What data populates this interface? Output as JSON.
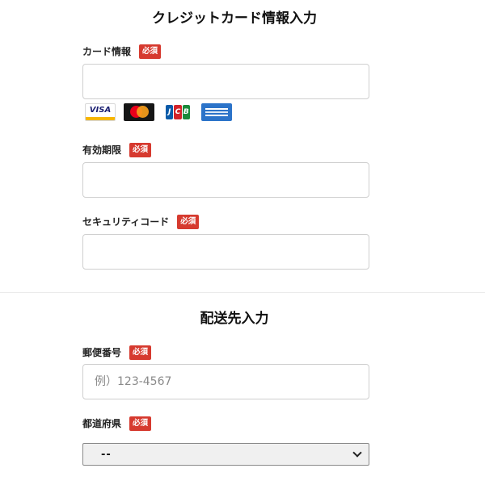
{
  "credit_section": {
    "title": "クレジットカード情報入力",
    "card_label": "カード情報",
    "card_value": "",
    "card_placeholder": "",
    "card_brands": [
      "VISA",
      "Mastercard",
      "JCB",
      "American Express"
    ],
    "visa_text": "VISA",
    "jcb_letters": [
      "J",
      "C",
      "B"
    ],
    "expiry_label": "有効期限",
    "expiry_value": "",
    "security_label": "セキュリティコード",
    "security_value": ""
  },
  "required_badge": "必須",
  "shipping_section": {
    "title": "配送先入力",
    "postal_label": "郵便番号",
    "postal_placeholder": "例）123-4567",
    "prefecture_label": "都道府県",
    "prefecture_selected": "--"
  },
  "colors": {
    "required_badge_bg": "#d63a2f",
    "input_border": "#cfcfcf"
  }
}
